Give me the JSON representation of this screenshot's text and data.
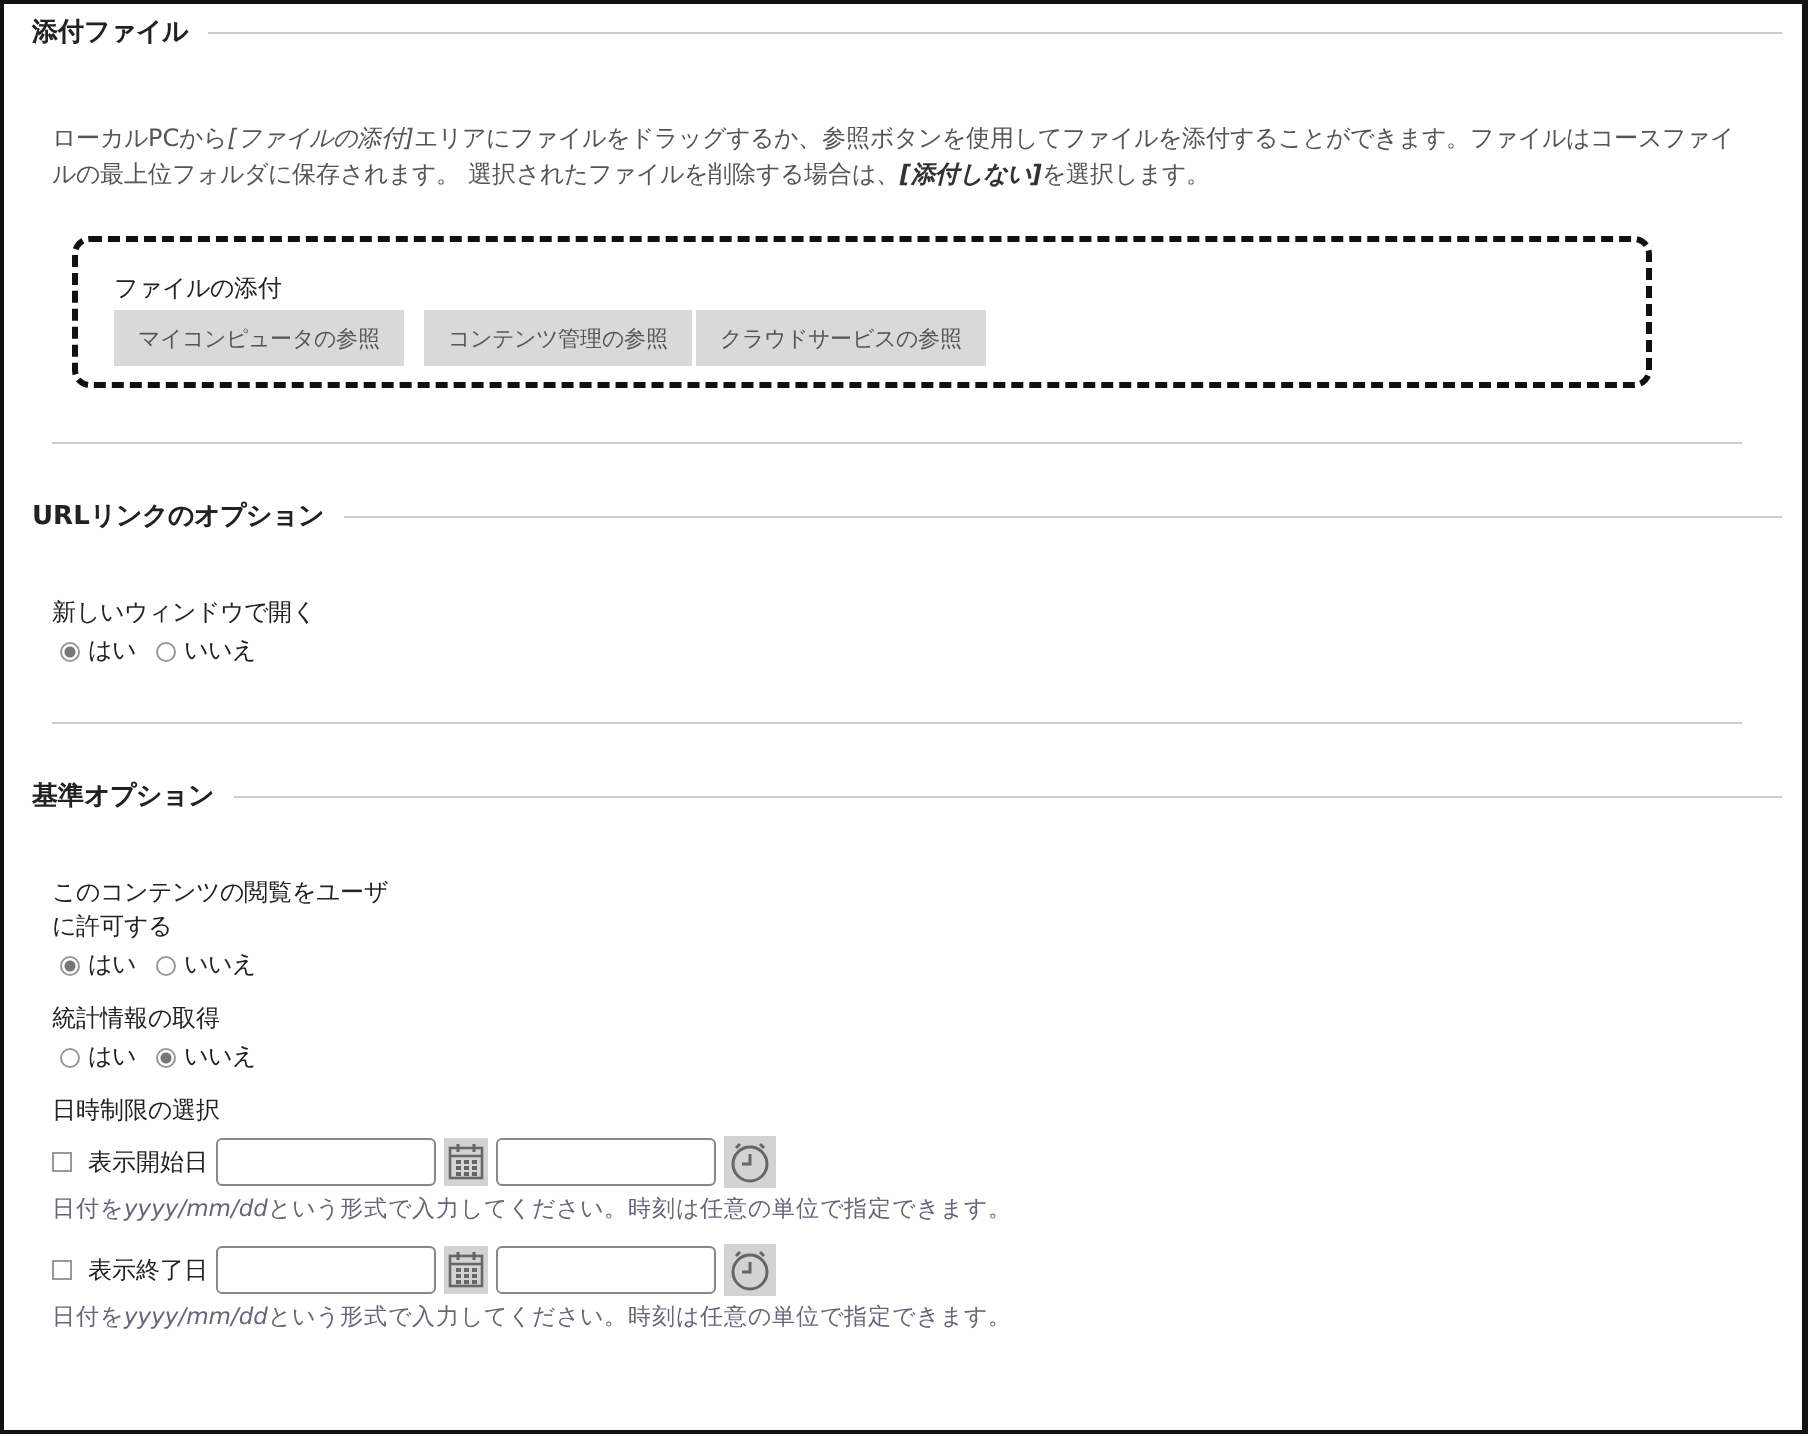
{
  "sections": [
    {
      "kind": "attach",
      "title": "添付ファイル",
      "description": [
        {
          "kind": "plain",
          "text": "ローカルPCから"
        },
        {
          "kind": "emphasis",
          "text": "[ファイルの添付]"
        },
        {
          "kind": "plain",
          "text": "エリアにファイルをドラッグするか、参照ボタンを使用してファイルを添付することができます。ファイルはコースファイルの最上位フォルダに保存されます。 選択されたファイルを削除する場合は、"
        },
        {
          "kind": "strong",
          "text": "[添付しない]"
        },
        {
          "kind": "plain",
          "text": "を選択します。"
        }
      ],
      "dropzone": {
        "label": "ファイルの添付",
        "buttons": [
          "マイコンピュータの参照",
          "コンテンツ管理の参照",
          "クラウドサービスの参照"
        ]
      }
    },
    {
      "kind": "options",
      "title": "URLリンクのオプション",
      "fields": [
        {
          "kind": "radio",
          "label": "新しいウィンドウで開く",
          "options": [
            {
              "label": "はい",
              "selected": true
            },
            {
              "label": "いいえ",
              "selected": false
            }
          ]
        }
      ]
    },
    {
      "kind": "options",
      "title": "基準オプション",
      "fields": [
        {
          "kind": "radio",
          "label": "このコンテンツの閲覧をユーザに許可する",
          "options": [
            {
              "label": "はい",
              "selected": true
            },
            {
              "label": "いいえ",
              "selected": false
            }
          ]
        },
        {
          "kind": "radio",
          "label": "統計情報の取得",
          "options": [
            {
              "label": "はい",
              "selected": false
            },
            {
              "label": "いいえ",
              "selected": true
            }
          ]
        },
        {
          "kind": "dates",
          "label": "日時制限の選択",
          "rows": [
            {
              "label": "表示開始日",
              "checked": false,
              "hint": [
                {
                  "kind": "plain",
                  "text": "日付を"
                },
                {
                  "kind": "emphasis",
                  "text": "yyyy/mm/dd"
                },
                {
                  "kind": "plain",
                  "text": "という形式で入力してください。時刻は任意の単位で指定できます。"
                }
              ]
            },
            {
              "label": "表示終了日",
              "checked": false,
              "hint": [
                {
                  "kind": "plain",
                  "text": "日付を"
                },
                {
                  "kind": "emphasis",
                  "text": "yyyy/mm/dd"
                },
                {
                  "kind": "plain",
                  "text": "という形式で入力してください。時刻は任意の単位で指定できます。"
                }
              ]
            }
          ]
        }
      ]
    }
  ]
}
